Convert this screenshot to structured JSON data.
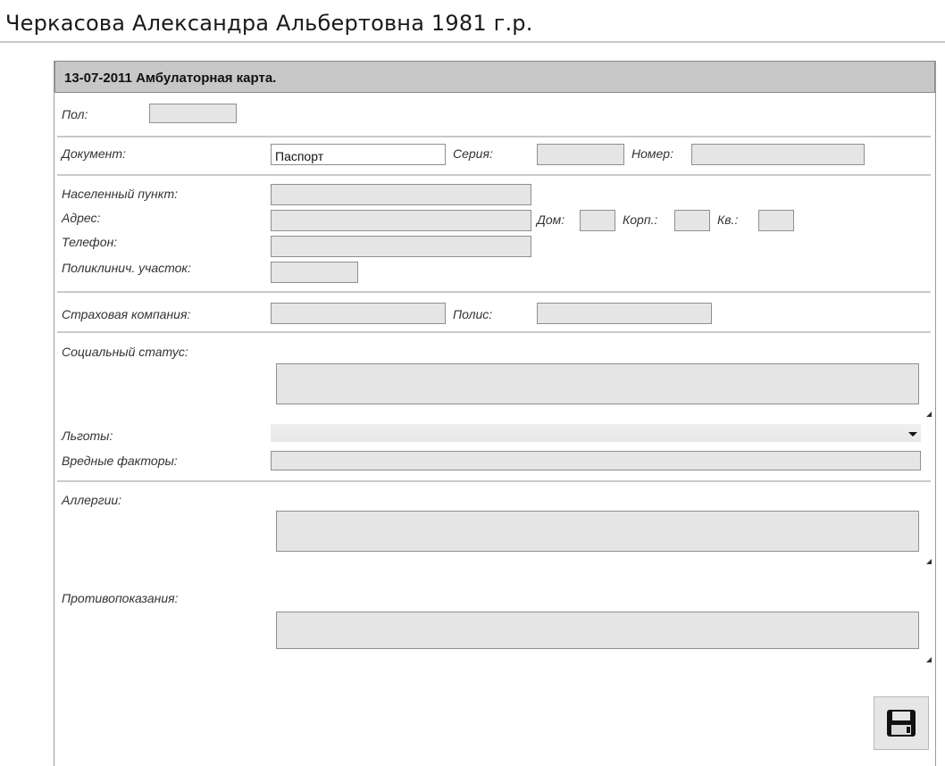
{
  "patient_header": {
    "name": "Черкасова Александра Альбертовна 1981 г.р."
  },
  "card": {
    "title": "13-07-2011 Амбулаторная карта."
  },
  "fields": {
    "sex": {
      "label": "Пол:",
      "value": ""
    },
    "document": {
      "label": "Документ:",
      "value": "Паспорт"
    },
    "series": {
      "label": "Серия:",
      "value": ""
    },
    "number": {
      "label": "Номер:",
      "value": ""
    },
    "locality": {
      "label": "Населенный пункт:",
      "value": ""
    },
    "address": {
      "label": "Адрес:",
      "value": ""
    },
    "house": {
      "label": "Дом:",
      "value": ""
    },
    "building": {
      "label": "Корп.:",
      "value": ""
    },
    "apartment": {
      "label": "Кв.:",
      "value": ""
    },
    "phone": {
      "label": "Телефон:",
      "value": ""
    },
    "clinic_area": {
      "label": "Поликлинич. участок:",
      "value": ""
    },
    "insurance": {
      "label": "Страховая компания:",
      "value": ""
    },
    "policy": {
      "label": "Полис:",
      "value": ""
    },
    "social_status": {
      "label": "Социальный статус:",
      "value": ""
    },
    "benefits": {
      "label": "Льготы:",
      "value": ""
    },
    "hazards": {
      "label": "Вредные факторы:",
      "value": ""
    },
    "allergies": {
      "label": "Аллергии:",
      "value": ""
    },
    "contraindications": {
      "label": "Противопоказания:",
      "value": ""
    }
  },
  "icons": {
    "save": "floppy-disk-icon"
  }
}
